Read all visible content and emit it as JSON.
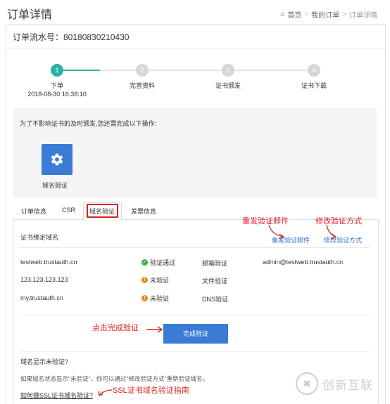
{
  "page": {
    "title": "订单详情"
  },
  "breadcrumb": {
    "home": "首页",
    "orders": "我的订单",
    "current": "订单详情",
    "sep": ">"
  },
  "order": {
    "serial": "订单流水号：80180830210430"
  },
  "steps": [
    {
      "num": "1",
      "label": "下单",
      "date": "2018-08-30 16:38:10",
      "active": true
    },
    {
      "num": "2",
      "label": "完善资料",
      "active": false
    },
    {
      "num": "3",
      "label": "证书颁发",
      "active": false
    },
    {
      "num": "4",
      "label": "证书下载",
      "active": false
    }
  ],
  "notice": {
    "text": "为了不影响证书的及时颁发,您还需完成以下操作:",
    "action_label": "域名验证",
    "action_icon": "gear-icon"
  },
  "tabs": [
    "订单信息",
    "CSR",
    "域名验证",
    "发票信息"
  ],
  "active_tab": "域名验证",
  "annotations": {
    "resend": "重发验证邮件",
    "modify": "修改验证方式",
    "finish": "点击完成验证",
    "guide": "SSL证书域名验证指南"
  },
  "domain_section": {
    "title": "证书绑定域名",
    "resend_link": "重发验证邮件",
    "modify_link": "修改验证方式",
    "rows": [
      {
        "domain": "testweb.trustauth.cn",
        "status": "验证通过",
        "status_type": "ok",
        "method": "邮箱验证",
        "detail": "admin@testweb.trustauth.cn"
      },
      {
        "domain": "123.123.123.123",
        "status": "未验证",
        "status_type": "warn",
        "method": "文件验证",
        "detail": ""
      },
      {
        "domain": "my.trustauth.cn",
        "status": "未验证",
        "status_type": "warn",
        "method": "DNS验证",
        "detail": ""
      }
    ],
    "finish_button": "完成验证"
  },
  "faq": {
    "question": "域名显示未验证?",
    "answer": "如果域名状态显示\"未验证\"，你可以通过\"修改验证方式\"重新验证域名。",
    "howto_link": "如何做SSL证书域名验证?"
  },
  "watermark": {
    "text": "创新互联"
  },
  "colors": {
    "accent": "#3a7bd5",
    "progress": "#2bb3a0",
    "annotation": "#e02020",
    "link": "#2d6fd6",
    "ok": "#3aae4a",
    "warn": "#f08a1e"
  }
}
